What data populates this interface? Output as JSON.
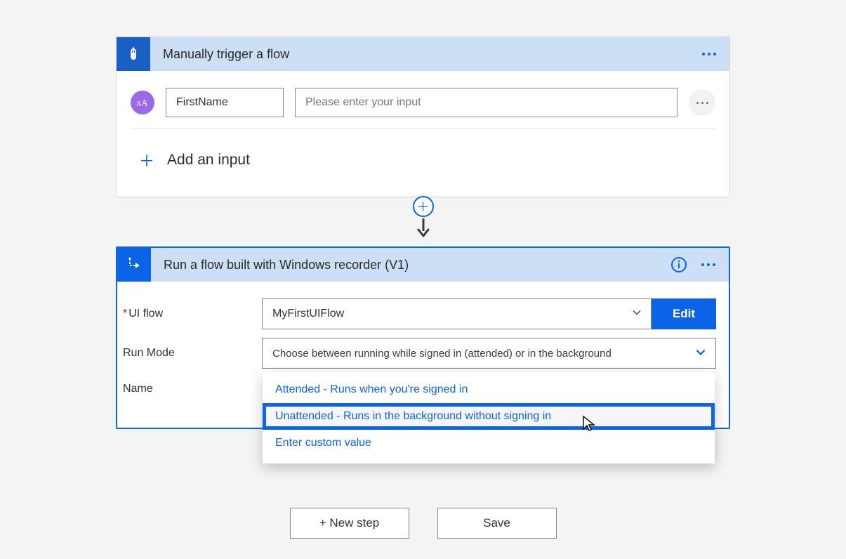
{
  "trigger": {
    "title": "Manually trigger a flow",
    "param_name": "FirstName",
    "param_placeholder": "Please enter your input",
    "add_input_label": "Add an input"
  },
  "action": {
    "title": "Run a flow built with Windows recorder (V1)",
    "fields": {
      "uiflow_label": "UI flow",
      "uiflow_value": "MyFirstUIFlow",
      "edit_label": "Edit",
      "runmode_label": "Run Mode",
      "runmode_placeholder": "Choose between running while signed in (attended) or in the background",
      "name_label": "Name"
    }
  },
  "dropdown": {
    "option1": "Attended - Runs when you're signed in",
    "option2": "Unattended - Runs in the background without signing in",
    "custom": "Enter custom value"
  },
  "footer": {
    "new_step": "+ New step",
    "save": "Save"
  }
}
